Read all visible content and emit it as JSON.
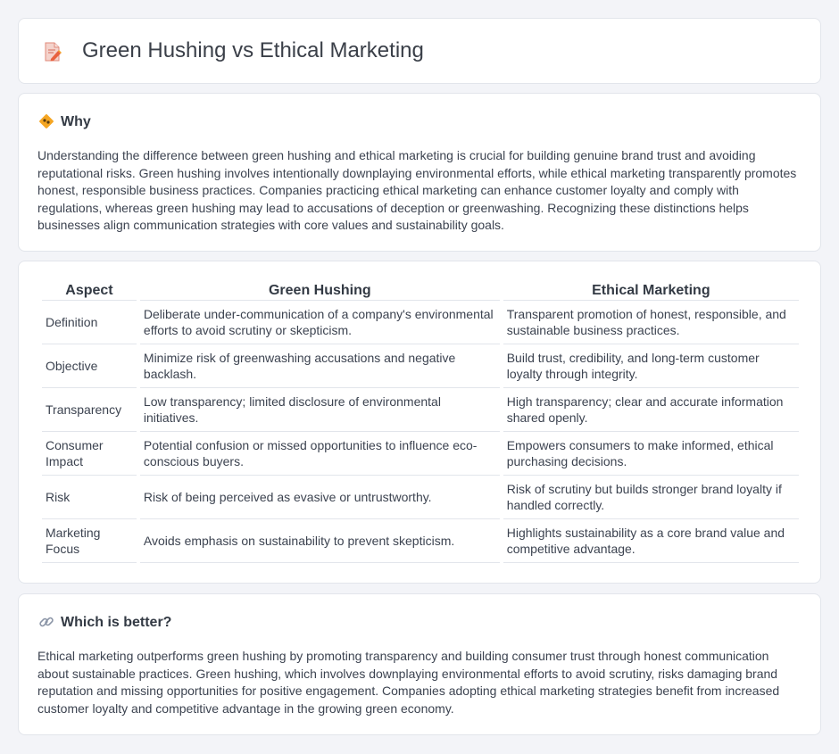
{
  "header": {
    "title": "Green Hushing vs Ethical Marketing",
    "icon": "document-pencil-icon"
  },
  "why": {
    "title": "Why",
    "icon": "diamond-sign-icon",
    "body": "Understanding the difference between green hushing and ethical marketing is crucial for building genuine brand trust and avoiding reputational risks. Green hushing involves intentionally downplaying environmental efforts, while ethical marketing transparently promotes honest, responsible business practices. Companies practicing ethical marketing can enhance customer loyalty and comply with regulations, whereas green hushing may lead to accusations of deception or greenwashing. Recognizing these distinctions helps businesses align communication strategies with core values and sustainability goals."
  },
  "table": {
    "headers": [
      "Aspect",
      "Green Hushing",
      "Ethical Marketing"
    ],
    "rows": [
      [
        "Definition",
        "Deliberate under-communication of a company's environmental efforts to avoid scrutiny or skepticism.",
        "Transparent promotion of honest, responsible, and sustainable business practices."
      ],
      [
        "Objective",
        "Minimize risk of greenwashing accusations and negative backlash.",
        "Build trust, credibility, and long-term customer loyalty through integrity."
      ],
      [
        "Transparency",
        "Low transparency; limited disclosure of environmental initiatives.",
        "High transparency; clear and accurate information shared openly."
      ],
      [
        "Consumer Impact",
        "Potential confusion or missed opportunities to influence eco-conscious buyers.",
        "Empowers consumers to make informed, ethical purchasing decisions."
      ],
      [
        "Risk",
        "Risk of being perceived as evasive or untrustworthy.",
        "Risk of scrutiny but builds stronger brand loyalty if handled correctly."
      ],
      [
        "Marketing Focus",
        "Avoids emphasis on sustainability to prevent skepticism.",
        "Highlights sustainability as a core brand value and competitive advantage."
      ]
    ]
  },
  "better": {
    "title": "Which is better?",
    "icon": "link-icon",
    "body": "Ethical marketing outperforms green hushing by promoting transparency and building consumer trust through honest communication about sustainable practices. Green hushing, which involves downplaying environmental efforts to avoid scrutiny, risks damaging brand reputation and missing opportunities for positive engagement. Companies adopting ethical marketing strategies benefit from increased customer loyalty and competitive advantage in the growing green economy."
  },
  "colors": {
    "background": "#f3f4f8",
    "card": "#ffffff",
    "border": "#e2e5eb",
    "accent_orange": "#f5a623",
    "icon_red": "#e06a5a"
  }
}
